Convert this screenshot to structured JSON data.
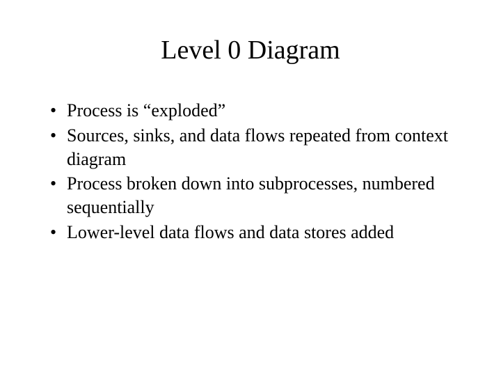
{
  "title": "Level 0 Diagram",
  "bullets": {
    "item0": "Process is “exploded”",
    "item1": "Sources, sinks, and data flows repeated from context diagram",
    "item2": "Process broken down into subprocesses, numbered sequentially",
    "item3": "Lower-level data flows and data stores added"
  }
}
